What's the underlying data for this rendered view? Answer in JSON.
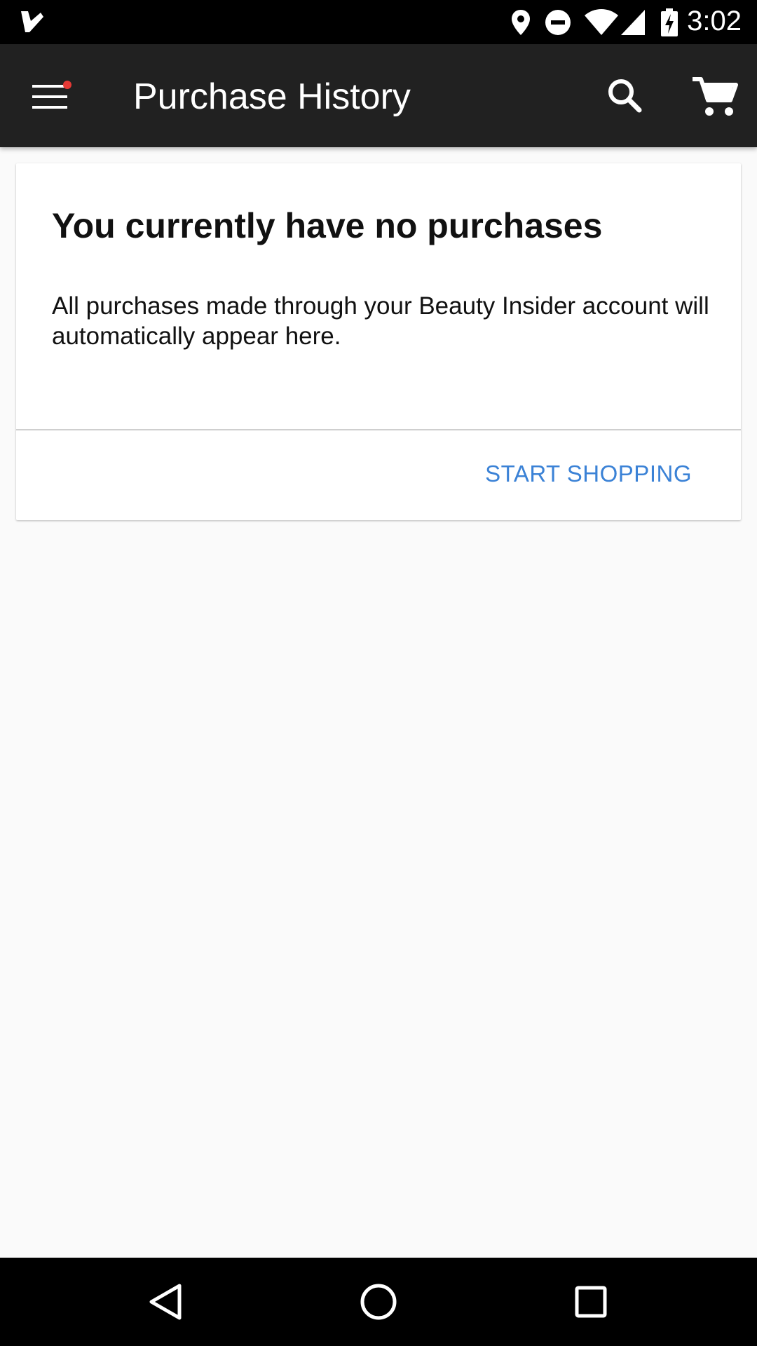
{
  "status_bar": {
    "time": "3:02",
    "icons": [
      "check-app-icon",
      "location-icon",
      "do-not-disturb-icon",
      "wifi-icon",
      "cell-signal-icon",
      "battery-charging-icon"
    ]
  },
  "app_bar": {
    "title": "Purchase History",
    "icons": [
      "menu-icon",
      "search-icon",
      "cart-icon"
    ],
    "notification_dot_color": "#e53935"
  },
  "empty_state": {
    "title": "You currently have no purchases",
    "body": "All purchases made through your Beauty Insider account will automatically appear here.",
    "action_label": "START SHOPPING",
    "action_color": "#3b82d6"
  },
  "nav_bar": {
    "icons": [
      "back-icon",
      "home-icon",
      "recents-icon"
    ]
  }
}
